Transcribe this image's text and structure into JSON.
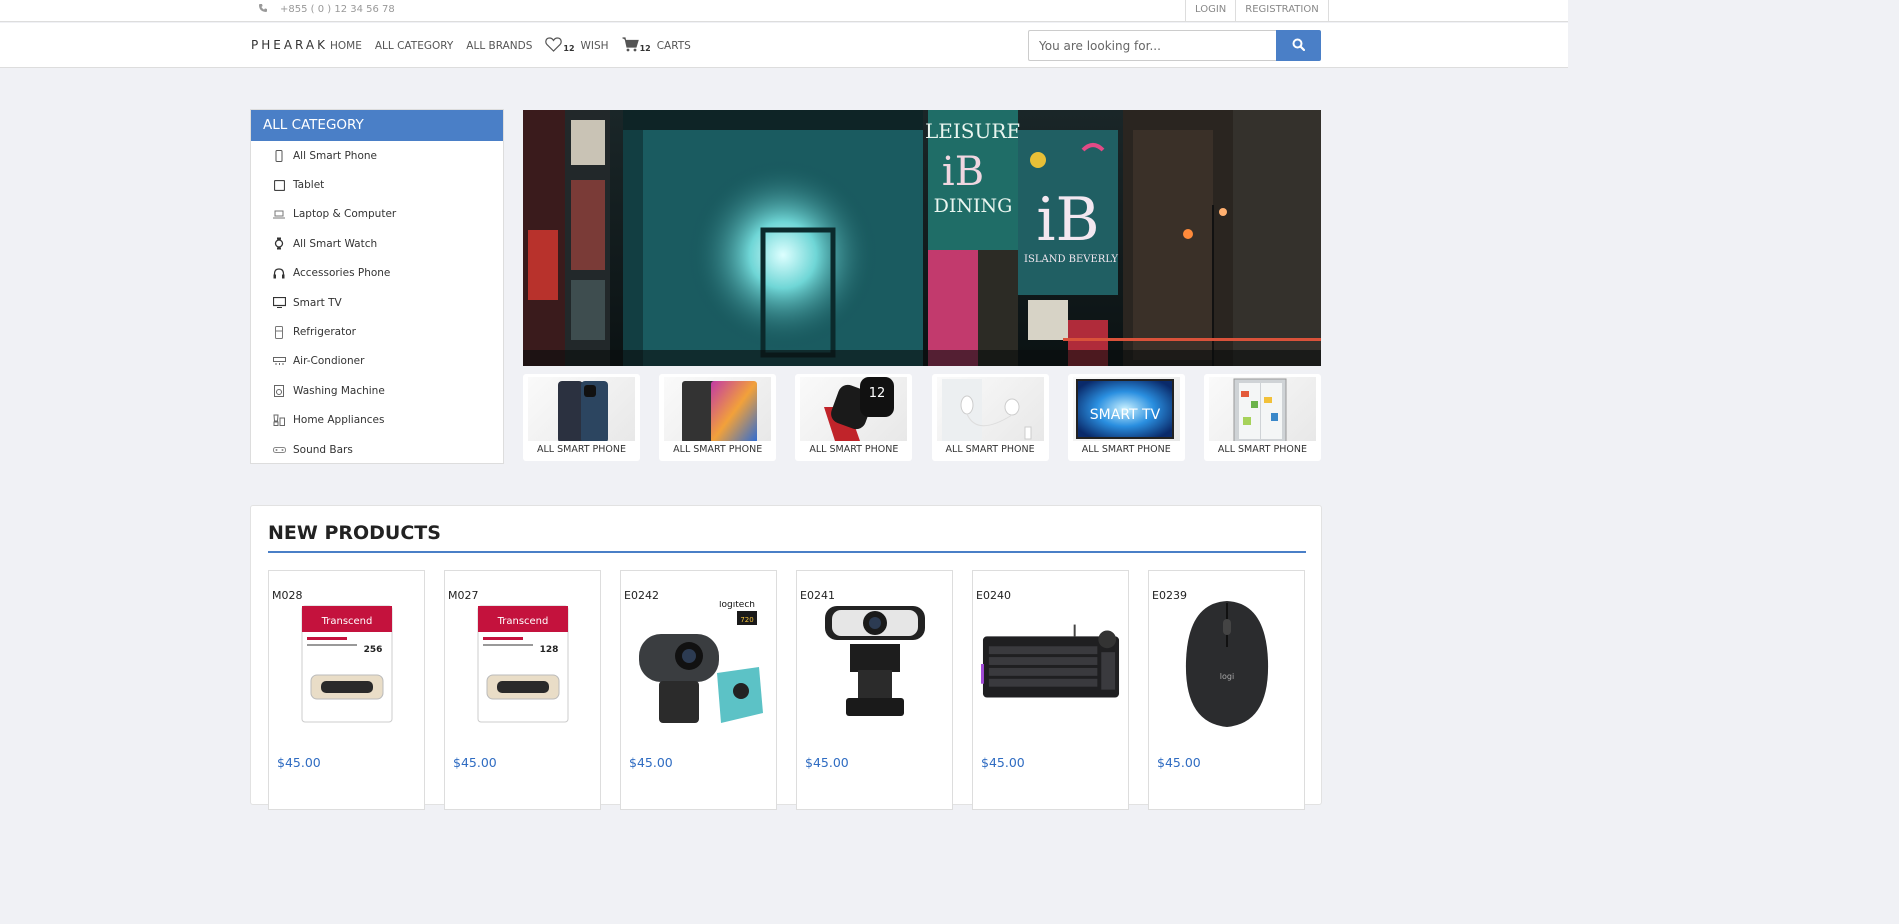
{
  "topbar": {
    "phone": "+855 ( 0 ) 12 34 56 78",
    "login": "LOGIN",
    "registration": "REGISTRATION"
  },
  "navbar": {
    "brand": "PHEARAK",
    "home": "HOME",
    "all_category": "ALL CATEGORY",
    "all_brands": "ALL BRANDS",
    "wish_count": "12",
    "wish_label": "WISH",
    "cart_count": "12",
    "cart_label": "CARTS",
    "search_placeholder": "You are looking for..."
  },
  "sidebar": {
    "title": "ALL CATEGORY",
    "items": [
      {
        "label": "All Smart Phone",
        "icon": "smartphone-icon"
      },
      {
        "label": "Tablet",
        "icon": "tablet-icon"
      },
      {
        "label": "Laptop & Computer",
        "icon": "laptop-icon"
      },
      {
        "label": "All Smart Watch",
        "icon": "watch-icon"
      },
      {
        "label": "Accessories Phone",
        "icon": "headphones-icon"
      },
      {
        "label": "Smart TV",
        "icon": "tv-icon"
      },
      {
        "label": "Refrigerator",
        "icon": "fridge-icon"
      },
      {
        "label": "Air-Condioner",
        "icon": "air-conditioner-icon"
      },
      {
        "label": "Washing Machine",
        "icon": "washing-machine-icon"
      },
      {
        "label": "Home Appliances",
        "icon": "blender-icon"
      },
      {
        "label": "Sound Bars",
        "icon": "soundbar-icon"
      }
    ]
  },
  "banner": {
    "sign_1": "LEISURE",
    "sign_2": "DINING",
    "sign_3": "ISLAND BEVERLY"
  },
  "tiles": [
    {
      "label": "ALL SMART PHONE"
    },
    {
      "label": "ALL SMART PHONE"
    },
    {
      "label": "ALL SMART PHONE"
    },
    {
      "label": "ALL SMART PHONE"
    },
    {
      "label": "ALL SMART PHONE",
      "overlay": "SMART TV"
    },
    {
      "label": "ALL SMART PHONE"
    }
  ],
  "products": {
    "title": "NEW PRODUCTS",
    "items": [
      {
        "code": "M028",
        "price": "$45.00",
        "brand": "Transcend",
        "capacity": "256"
      },
      {
        "code": "M027",
        "price": "$45.00",
        "brand": "Transcend",
        "capacity": "128"
      },
      {
        "code": "E0242",
        "price": "$45.00",
        "brand": "logitech",
        "badge": "720"
      },
      {
        "code": "E0241",
        "price": "$45.00"
      },
      {
        "code": "E0240",
        "price": "$45.00"
      },
      {
        "code": "E0239",
        "price": "$45.00",
        "brand": "logi"
      }
    ]
  },
  "colors": {
    "accent": "#4a7fc7",
    "price": "#2f6cc2",
    "background": "#f0f1f5"
  }
}
